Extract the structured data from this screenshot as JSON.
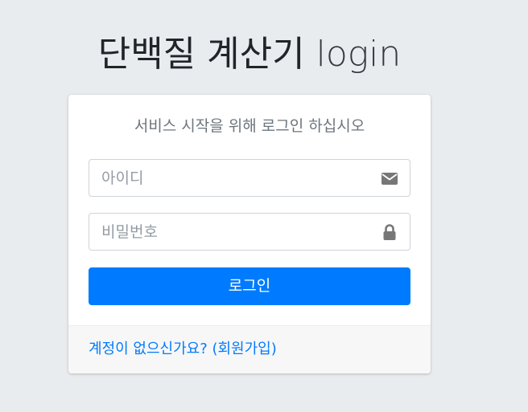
{
  "logo": {
    "main": "단백질 계산기",
    "sub": "login"
  },
  "card": {
    "message": "서비스 시작을 위해 로그인 하십시오",
    "id_input": {
      "placeholder": "아이디",
      "value": "",
      "icon": "envelope-icon"
    },
    "pw_input": {
      "placeholder": "비밀번호",
      "value": "",
      "icon": "lock-icon"
    },
    "login_button": "로그인",
    "footer_link": "계정이 없으신가요? (회원가입)"
  },
  "colors": {
    "background": "#e9ecef",
    "primary": "#007bff",
    "muted": "#6c757d",
    "icon": "#777777"
  }
}
